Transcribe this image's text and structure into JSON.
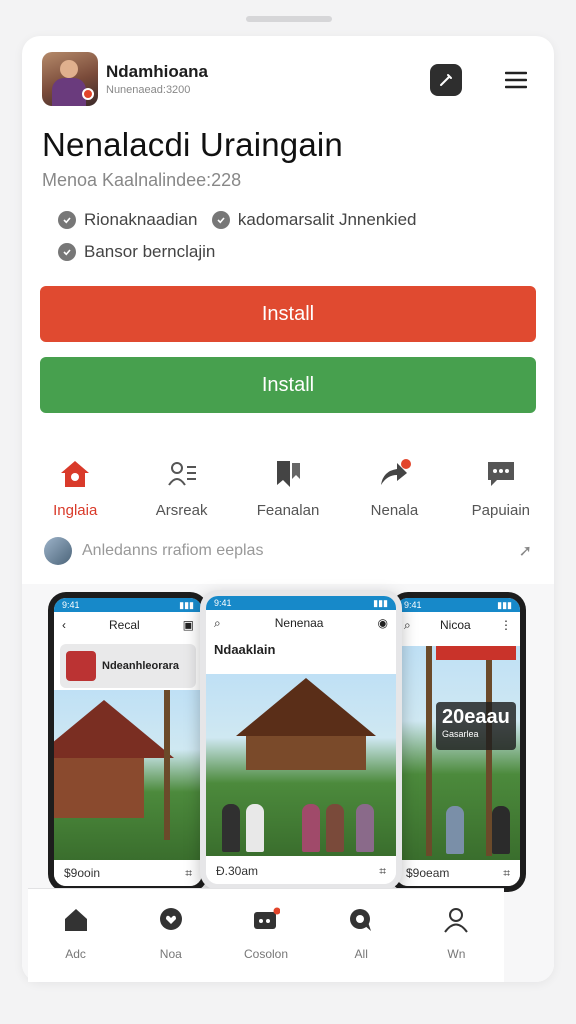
{
  "app": {
    "name": "Ndamhioana",
    "meta": "Nunenaead:3200",
    "title": "Nenalacdi Uraingain",
    "subtitle": "Menoa Kaalnalindee:228"
  },
  "tags": [
    {
      "label": "Rionaknaadian"
    },
    {
      "label": "kadomarsalit Jnnenkied"
    },
    {
      "label": "Bansor bernclajin"
    }
  ],
  "buttons": {
    "primary_label": "Install",
    "secondary_label": "Install"
  },
  "nav": {
    "items": [
      {
        "label": "Inglaia",
        "icon": "home-icon",
        "active": true
      },
      {
        "label": "Arsreak",
        "icon": "person-list-icon",
        "active": false
      },
      {
        "label": "Feanalan",
        "icon": "bookmark-icon",
        "active": false
      },
      {
        "label": "Nenala",
        "icon": "share-icon",
        "active": false
      },
      {
        "label": "Papuiain",
        "icon": "chat-icon",
        "active": false
      }
    ]
  },
  "promo": {
    "text": "Anledanns rrafiom eeplas"
  },
  "phones": {
    "left": {
      "time": "9:41",
      "title": "Recal",
      "card_title": "Ndeanhleorara",
      "footer_left": "$9ooin",
      "footer_right": ""
    },
    "center": {
      "time": "9:41",
      "title": "Nenenaa",
      "card_title": "Ndaaklain",
      "card_sub": "",
      "footer_left": "Ð.30am",
      "footer_right": ""
    },
    "right": {
      "time": "9:41",
      "title": "Nicoa",
      "banner_big": "20eaau",
      "banner_small": "Gasarlea",
      "footer_left": "$9oeam",
      "footer_right": ""
    }
  },
  "bottom_bar": {
    "items": [
      {
        "label": "Adc",
        "icon": "home-icon"
      },
      {
        "label": "Noa",
        "icon": "heart-icon"
      },
      {
        "label": "Cosolon",
        "icon": "video-icon"
      },
      {
        "label": "All",
        "icon": "chat-icon"
      },
      {
        "label": "Wn",
        "icon": "profile-icon"
      }
    ]
  },
  "colors": {
    "accent_red": "#e04a30",
    "accent_green": "#47a04e",
    "status_blue": "#1789c9"
  }
}
